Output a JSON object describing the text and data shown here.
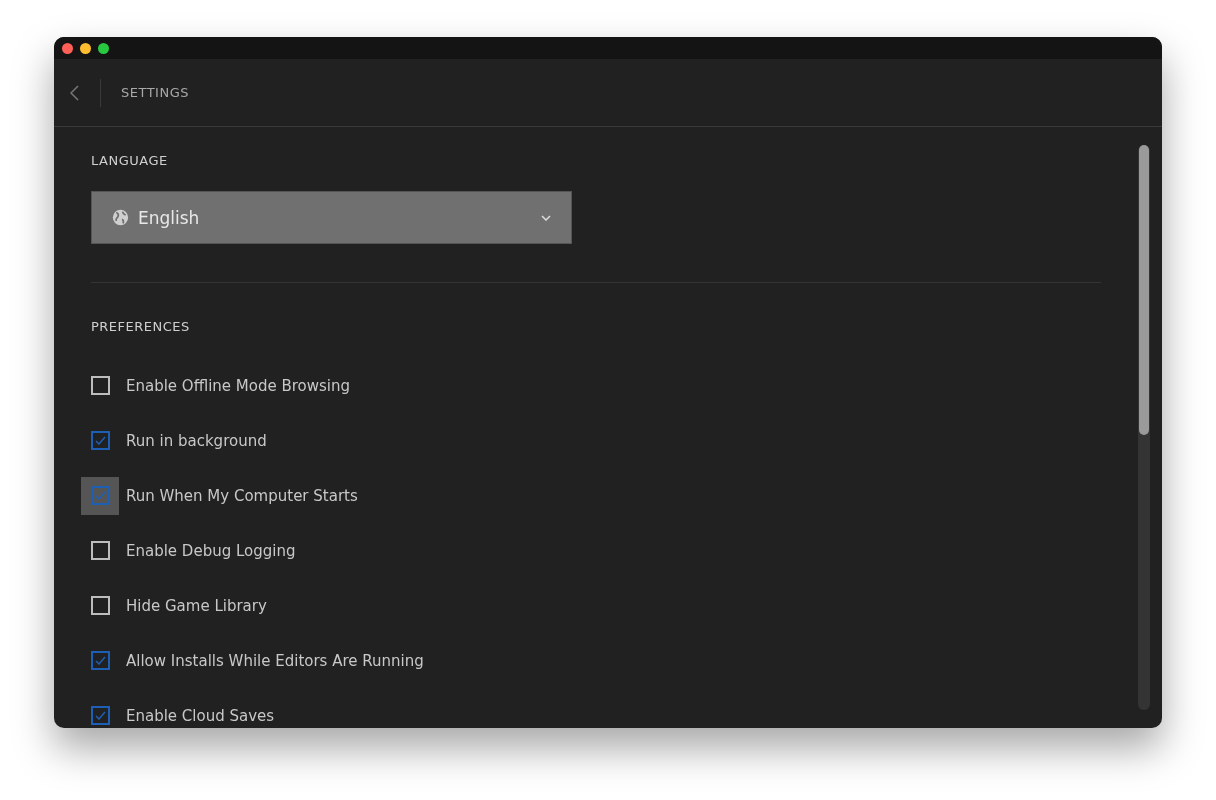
{
  "header": {
    "title": "SETTINGS"
  },
  "language": {
    "heading": "LANGUAGE",
    "value": "English"
  },
  "preferences": {
    "heading": "PREFERENCES",
    "items": [
      {
        "label": "Enable Offline Mode Browsing",
        "checked": false,
        "focused": false
      },
      {
        "label": "Run in background",
        "checked": true,
        "focused": false
      },
      {
        "label": "Run When My Computer Starts",
        "checked": true,
        "focused": true
      },
      {
        "label": "Enable Debug Logging",
        "checked": false,
        "focused": false
      },
      {
        "label": "Hide Game Library",
        "checked": false,
        "focused": false
      },
      {
        "label": "Allow Installs While Editors Are Running",
        "checked": true,
        "focused": false
      },
      {
        "label": "Enable Cloud Saves",
        "checked": true,
        "focused": false
      }
    ]
  }
}
